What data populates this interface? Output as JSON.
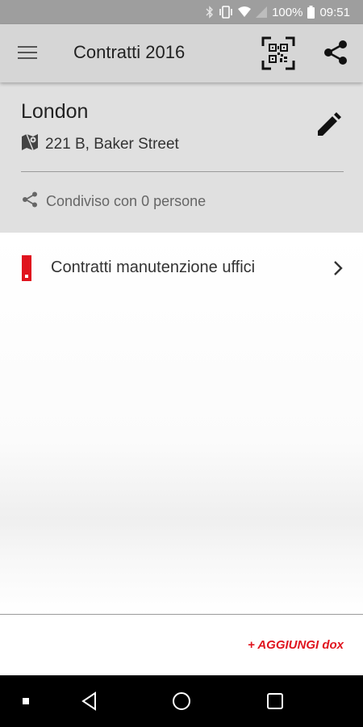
{
  "status_bar": {
    "battery": "100%",
    "time": "09:51"
  },
  "app_bar": {
    "title": "Contratti 2016"
  },
  "location": {
    "name": "London",
    "address": "221 B, Baker Street",
    "shared_text": "Condiviso con 0 persone"
  },
  "items": [
    {
      "label": "Contratti manutenzione uffici"
    }
  ],
  "footer": {
    "add_label": "+ AGGIUNGI dox"
  },
  "colors": {
    "accent": "#e0141e",
    "app_bar": "#d6d6d6",
    "header_bg": "#e0e0e0",
    "status_bar": "#9e9e9e"
  }
}
